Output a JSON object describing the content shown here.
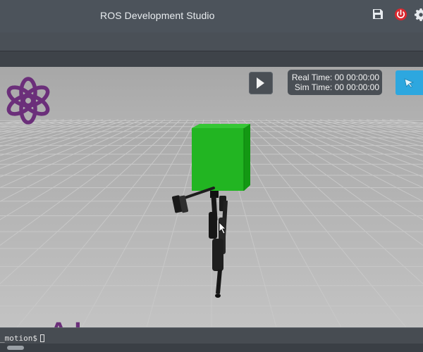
{
  "titlebar": {
    "title": "ROS Development Studio",
    "icons": [
      "save-icon",
      "power-icon",
      "settings-icon"
    ],
    "power_color": "#d9272e"
  },
  "simulation": {
    "play_icon": "play-icon",
    "real_time_label": "Real Time:",
    "real_time_value": "00 00:00:00",
    "sim_time_label": "Sim Time:",
    "sim_time_value": "00 00:00:00",
    "view_icon": "select-arrow-icon",
    "view_button_color": "#2da7df",
    "robot_body_color": "#22b522"
  },
  "watermark": {
    "text": "enAI",
    "color": "#6b2f7a",
    "logo": "openai-knot-logo"
  },
  "terminal": {
    "prompt": "_motion$"
  }
}
